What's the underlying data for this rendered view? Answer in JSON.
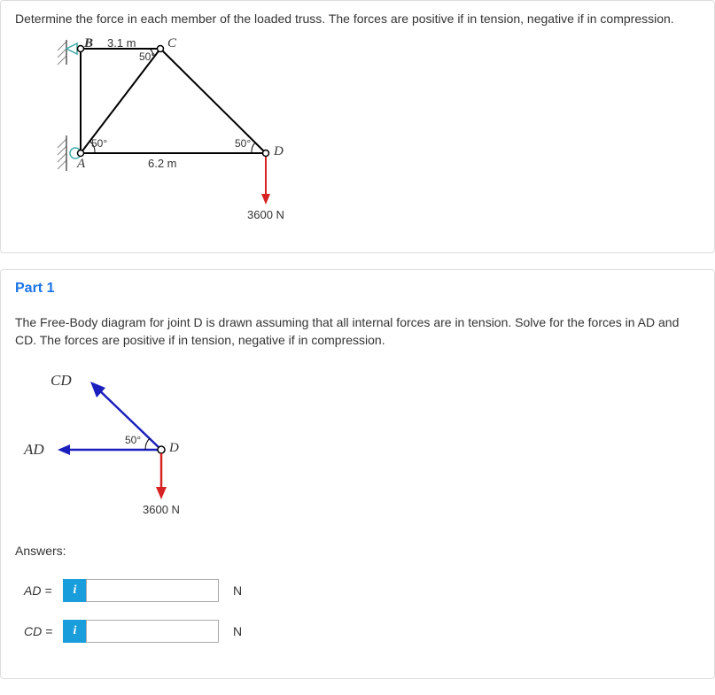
{
  "question": "Determine the force in each member of the loaded truss. The forces are positive if in tension, negative if in compression.",
  "diagram1": {
    "pt_B": "B",
    "pt_C": "C",
    "pt_A": "A",
    "pt_D": "D",
    "len_BC": "3.1 m",
    "len_AD": "6.2 m",
    "angle_C": "50°",
    "angle_A": "50°",
    "angle_D": "50°",
    "load": "3600 N"
  },
  "part1": {
    "title": "Part 1",
    "text": "The Free-Body diagram for joint D is drawn assuming that all internal forces are in tension. Solve for the forces in AD and CD. The forces are positive if in tension, negative if in compression.",
    "fbd": {
      "CD": "CD",
      "AD": "AD",
      "D": "D",
      "angle": "50°",
      "load": "3600 N"
    },
    "answers_label": "Answers:",
    "rows": [
      {
        "label": "AD =",
        "unit": "N"
      },
      {
        "label": "CD =",
        "unit": "N"
      }
    ],
    "info_glyph": "i"
  }
}
